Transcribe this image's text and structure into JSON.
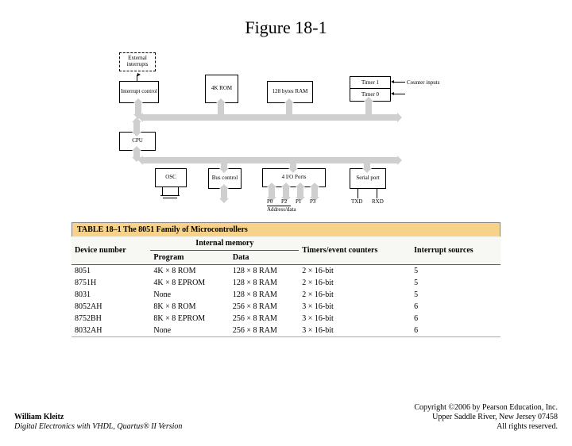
{
  "title": "Figure 18-1",
  "diagram": {
    "ext_int": "External interrupts",
    "int_ctrl": "Interrupt control",
    "rom": "4K ROM",
    "ram": "128 bytes RAM",
    "timer1": "Timer 1",
    "timer0": "Timer 0",
    "counter_in": "Counter inputs",
    "cpu": "CPU",
    "osc": "OSC",
    "bus_ctrl": "Bus control",
    "io_ports": "4 I/O Ports",
    "serial": "Serial port",
    "p0": "P0",
    "p2": "P2",
    "p1": "P1",
    "p3": "P3",
    "txd": "TXD",
    "rxd": "RXD",
    "addr_data": "Address/data"
  },
  "table": {
    "title": "TABLE 18–1   The 8051 Family of Microcontrollers",
    "group_header": "Internal memory",
    "cols": [
      "Device number",
      "Program",
      "Data",
      "Timers/event counters",
      "Interrupt sources"
    ],
    "rows": [
      [
        "8051",
        "4K × 8 ROM",
        "128 × 8 RAM",
        "2 × 16-bit",
        "5"
      ],
      [
        "8751H",
        "4K × 8 EPROM",
        "128 × 8 RAM",
        "2 × 16-bit",
        "5"
      ],
      [
        "8031",
        "None",
        "128 × 8 RAM",
        "2 × 16-bit",
        "5"
      ],
      [
        "8052AH",
        "8K × 8 ROM",
        "256 × 8 RAM",
        "3 × 16-bit",
        "6"
      ],
      [
        "8752BH",
        "8K × 8 EPROM",
        "256 × 8 RAM",
        "3 × 16-bit",
        "6"
      ],
      [
        "8032AH",
        "None",
        "256 × 8 RAM",
        "3 × 16-bit",
        "6"
      ]
    ]
  },
  "footer": {
    "author": "William Kleitz",
    "book": "Digital Electronics with VHDL, Quartus® II Version",
    "copyright": "Copyright ©2006 by Pearson Education, Inc.",
    "addr": "Upper Saddle River, New Jersey 07458",
    "rights": "All rights reserved."
  }
}
